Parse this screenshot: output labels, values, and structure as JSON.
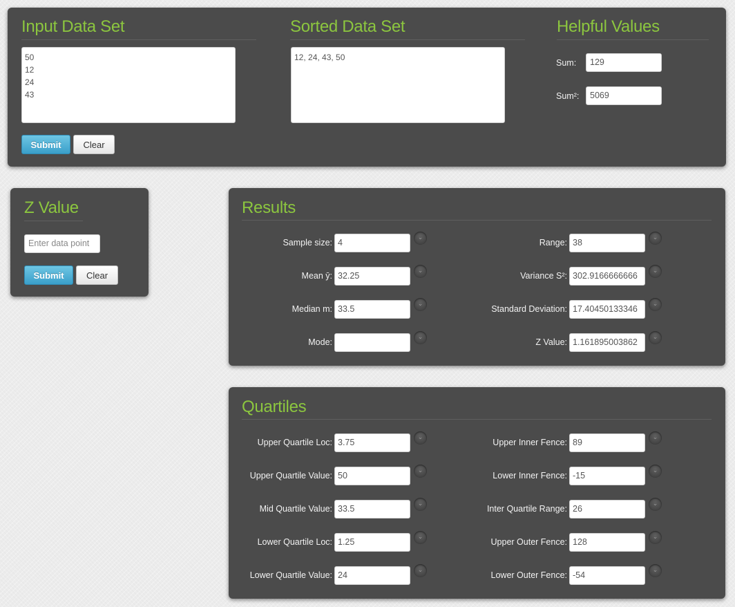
{
  "input_panel": {
    "title": "Input Data Set",
    "data": "50\n12\n24\n43",
    "submit_label": "Submit",
    "clear_label": "Clear"
  },
  "sorted_panel": {
    "title": "Sorted Data Set",
    "data": "12, 24, 43, 50"
  },
  "helpful_panel": {
    "title": "Helpful Values",
    "sum_label": "Sum:",
    "sum_value": "129",
    "sum_sq_label": "Sum²:",
    "sum_sq_value": "5069"
  },
  "z_panel": {
    "title": "Z Value",
    "placeholder": "Enter data point",
    "submit_label": "Submit",
    "clear_label": "Clear"
  },
  "results": {
    "title": "Results",
    "sample_size": {
      "label": "Sample size:",
      "value": "4"
    },
    "mean": {
      "label": "Mean ȳ:",
      "value": "32.25"
    },
    "median": {
      "label": "Median m:",
      "value": "33.5"
    },
    "mode": {
      "label": "Mode:",
      "value": ""
    },
    "range": {
      "label": "Range:",
      "value": "38"
    },
    "variance": {
      "label": "Variance S²:",
      "value": "302.9166666666"
    },
    "std_dev": {
      "label": "Standard Deviation:",
      "value": "17.40450133346"
    },
    "z_value": {
      "label": "Z Value:",
      "value": "1.161895003862"
    }
  },
  "quartiles": {
    "title": "Quartiles",
    "upper_quartile_loc": {
      "label": "Upper Quartile Loc:",
      "value": "3.75"
    },
    "upper_quartile_value": {
      "label": "Upper Quartile Value:",
      "value": "50"
    },
    "mid_quartile_value": {
      "label": "Mid Quartile Value:",
      "value": "33.5"
    },
    "lower_quartile_loc": {
      "label": "Lower Quartile Loc:",
      "value": "1.25"
    },
    "lower_quartile_value": {
      "label": "Lower Quartile Value:",
      "value": "24"
    },
    "upper_inner_fence": {
      "label": "Upper Inner Fence:",
      "value": "89"
    },
    "lower_inner_fence": {
      "label": "Lower Inner Fence:",
      "value": "-15"
    },
    "inter_quartile_range": {
      "label": "Inter Quartile Range:",
      "value": "26"
    },
    "upper_outer_fence": {
      "label": "Upper Outer Fence:",
      "value": "128"
    },
    "lower_outer_fence": {
      "label": "Lower Outer Fence:",
      "value": "-54"
    }
  },
  "icons": {
    "info_toggle": "chevron-down-icon"
  },
  "colors": {
    "accent": "#8cc63f",
    "panel": "#4b4b4b",
    "primary_button": "#3a9fca"
  }
}
